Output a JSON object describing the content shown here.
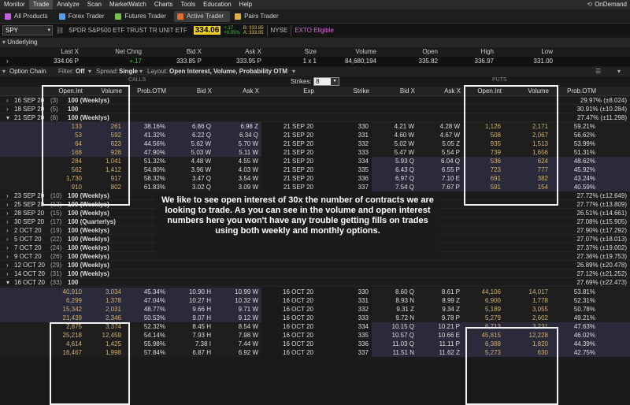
{
  "menu": [
    "Monitor",
    "Trade",
    "Analyze",
    "Scan",
    "MarketWatch",
    "Charts",
    "Tools",
    "Education",
    "Help"
  ],
  "menu_active": "Trade",
  "ondemand": "OnDemand",
  "tabs": [
    {
      "label": "All Products",
      "icon": "grid-icon",
      "color": "#c060e0"
    },
    {
      "label": "Forex Trader",
      "icon": "forex-icon",
      "color": "#5aa0e0"
    },
    {
      "label": "Futures Trader",
      "icon": "futures-icon",
      "color": "#7ac050"
    },
    {
      "label": "Active Trader",
      "icon": "active-trader-icon",
      "color": "#e07030"
    },
    {
      "label": "Pairs Trader",
      "icon": "pairs-icon",
      "color": "#e0b040"
    }
  ],
  "symbol": {
    "ticker": "SPY",
    "name": "SPDR S&P500 ETF TRUST TR UNIT ETF",
    "price": "334.06",
    "change": "+.17",
    "change_pct": "+0.05%",
    "bid": "B: 333.85",
    "ask": "A: 333.95",
    "exchange": "NYSE",
    "status": "EXTO Eligible"
  },
  "underlying": {
    "title": "Underlying",
    "columns": [
      "Last X",
      "Net Chng",
      "Bid X",
      "Ask X",
      "Size",
      "Volume",
      "Open",
      "High",
      "Low"
    ],
    "values": [
      "334.06 P",
      "+.17",
      "333.85 P",
      "333.95 P",
      "1 x 1",
      "84,680,194",
      "335.82",
      "336.97",
      "331.00"
    ]
  },
  "chain_bar": {
    "title": "Option Chain",
    "filter_label": "Filter:",
    "filter_value": "Off",
    "spread_label": "Spread:",
    "spread_value": "Single",
    "layout_label": "Layout:",
    "layout_value": "Open Interest, Volume, Probability OTM"
  },
  "calls_label": "CALLS",
  "puts_label": "PUTS",
  "strikes_label": "Strikes:",
  "strikes_value": "8",
  "headers": {
    "call": [
      "Open.Int",
      "Volume",
      "Prob.OTM",
      "Bid X",
      "Ask X"
    ],
    "mid": [
      "Exp",
      "Strike"
    ],
    "put": [
      "Bid X",
      "Ask X",
      "Open.Int",
      "Volume",
      "Prob.OTM"
    ]
  },
  "expirations_top": [
    {
      "date": "16 SEP 20",
      "days": "(3)",
      "series": "100 (Weeklys)",
      "prob": "29.97% (±8.024)",
      "open": false
    },
    {
      "date": "18 SEP 20",
      "days": "(5)",
      "series": "100",
      "prob": "30.91% (±10.284)",
      "open": false
    },
    {
      "date": "21 SEP 20",
      "days": "(8)",
      "series": "100 (Weeklys)",
      "prob": "27.47% (±11.298)",
      "open": true
    }
  ],
  "rows_sep21": [
    {
      "c_oi": "133",
      "c_vol": "261",
      "c_prob": "38.16%",
      "c_bid": "6.86 Q",
      "c_ask": "6.98 Z",
      "exp": "21 SEP 20",
      "strike": "330",
      "p_bid": "4.21 W",
      "p_ask": "4.28 W",
      "p_oi": "1,126",
      "p_vol": "2,171",
      "p_prob": "59.21%"
    },
    {
      "c_oi": "53",
      "c_vol": "592",
      "c_prob": "41.32%",
      "c_bid": "6.22 Q",
      "c_ask": "6.34 Q",
      "exp": "21 SEP 20",
      "strike": "331",
      "p_bid": "4.60 W",
      "p_ask": "4.67 W",
      "p_oi": "508",
      "p_vol": "2,067",
      "p_prob": "56.62%"
    },
    {
      "c_oi": "64",
      "c_vol": "623",
      "c_prob": "44.56%",
      "c_bid": "5.62 W",
      "c_ask": "5.70 W",
      "exp": "21 SEP 20",
      "strike": "332",
      "p_bid": "5.02 W",
      "p_ask": "5.05 Z",
      "p_oi": "935",
      "p_vol": "1,513",
      "p_prob": "53.99%"
    },
    {
      "c_oi": "168",
      "c_vol": "926",
      "c_prob": "47.90%",
      "c_bid": "5.03 W",
      "c_ask": "5.11 W",
      "exp": "21 SEP 20",
      "strike": "333",
      "p_bid": "5.47 W",
      "p_ask": "5.54 P",
      "p_oi": "739",
      "p_vol": "1,656",
      "p_prob": "51.31%"
    },
    {
      "c_oi": "284",
      "c_vol": "1,041",
      "c_prob": "51.32%",
      "c_bid": "4.48 W",
      "c_ask": "4.55 W",
      "exp": "21 SEP 20",
      "strike": "334",
      "p_bid": "5.93 Q",
      "p_ask": "6.04 Q",
      "p_oi": "536",
      "p_vol": "624",
      "p_prob": "48.62%"
    },
    {
      "c_oi": "562",
      "c_vol": "1,412",
      "c_prob": "54.80%",
      "c_bid": "3.96 W",
      "c_ask": "4.03 W",
      "exp": "21 SEP 20",
      "strike": "335",
      "p_bid": "6.43 Q",
      "p_ask": "6.55 P",
      "p_oi": "723",
      "p_vol": "777",
      "p_prob": "45.92%"
    },
    {
      "c_oi": "1,730",
      "c_vol": "917",
      "c_prob": "58.32%",
      "c_bid": "3.47 Q",
      "c_ask": "3.54 W",
      "exp": "21 SEP 20",
      "strike": "336",
      "p_bid": "6.97 Q",
      "p_ask": "7.10 E",
      "p_oi": "691",
      "p_vol": "382",
      "p_prob": "43.24%"
    },
    {
      "c_oi": "910",
      "c_vol": "802",
      "c_prob": "61.83%",
      "c_bid": "3.02 Q",
      "c_ask": "3.09 W",
      "exp": "21 SEP 20",
      "strike": "337",
      "p_bid": "7.54 Q",
      "p_ask": "7.67 P",
      "p_oi": "591",
      "p_vol": "154",
      "p_prob": "40.59%"
    }
  ],
  "expirations_mid": [
    {
      "date": "23 SEP 20",
      "days": "(10)",
      "series": "100 (Weeklys)",
      "prob": "27.72% (±12.649)"
    },
    {
      "date": "25 SEP 20",
      "days": "(12)",
      "series": "100 (Weeklys)",
      "prob": "27.77% (±13.809)"
    },
    {
      "date": "28 SEP 20",
      "days": "(15)",
      "series": "100 (Weeklys)",
      "prob": "26.51% (±14.661)"
    },
    {
      "date": "30 SEP 20",
      "days": "(17)",
      "series": "100 (Quarterlys)",
      "prob": "27.08% (±15.905)"
    },
    {
      "date": "2 OCT 20",
      "days": "(19)",
      "series": "100 (Weeklys)",
      "prob": "27.90% (±17.292)"
    },
    {
      "date": "5 OCT 20",
      "days": "(22)",
      "series": "100 (Weeklys)",
      "prob": "27.07% (±18.013)"
    },
    {
      "date": "7 OCT 20",
      "days": "(24)",
      "series": "100 (Weeklys)",
      "prob": "27.37% (±19.002)"
    },
    {
      "date": "9 OCT 20",
      "days": "(26)",
      "series": "100 (Weeklys)",
      "prob": "27.36% (±19.753)"
    },
    {
      "date": "12 OCT 20",
      "days": "(29)",
      "series": "100 (Weeklys)",
      "prob": "26.89% (±20.478)"
    },
    {
      "date": "14 OCT 20",
      "days": "(31)",
      "series": "100 (Weeklys)",
      "prob": "27.12% (±21.252)"
    },
    {
      "date": "16 OCT 20",
      "days": "(33)",
      "series": "100",
      "prob": "27.69% (±22.473)"
    }
  ],
  "rows_oct16": [
    {
      "c_oi": "40,910",
      "c_vol": "3,034",
      "c_prob": "45.34%",
      "c_bid": "10.90 H",
      "c_ask": "10.99 W",
      "exp": "16 OCT 20",
      "strike": "330",
      "p_bid": "8.60 Q",
      "p_ask": "8.61 P",
      "p_oi": "44,106",
      "p_vol": "14,017",
      "p_prob": "53.81%"
    },
    {
      "c_oi": "6,299",
      "c_vol": "1,378",
      "c_prob": "47.04%",
      "c_bid": "10.27 H",
      "c_ask": "10.32 W",
      "exp": "16 OCT 20",
      "strike": "331",
      "p_bid": "8.93 N",
      "p_ask": "8.99 Z",
      "p_oi": "6,900",
      "p_vol": "1,778",
      "p_prob": "52.31%"
    },
    {
      "c_oi": "15,342",
      "c_vol": "2,031",
      "c_prob": "48.77%",
      "c_bid": "9.66 H",
      "c_ask": "9.71 W",
      "exp": "16 OCT 20",
      "strike": "332",
      "p_bid": "9.31 Z",
      "p_ask": "9.34 Z",
      "p_oi": "5,189",
      "p_vol": "3,055",
      "p_prob": "50.78%"
    },
    {
      "c_oi": "21,439",
      "c_vol": "2,346",
      "c_prob": "50.53%",
      "c_bid": "9.07 H",
      "c_ask": "9.12 W",
      "exp": "16 OCT 20",
      "strike": "333",
      "p_bid": "9.72 N",
      "p_ask": "9.78 P",
      "p_oi": "5,279",
      "p_vol": "2,602",
      "p_prob": "49.21%"
    },
    {
      "c_oi": "2,875",
      "c_vol": "3,374",
      "c_prob": "52.32%",
      "c_bid": "8.45 H",
      "c_ask": "8.54 W",
      "exp": "16 OCT 20",
      "strike": "334",
      "p_bid": "10.15 Q",
      "p_ask": "10.21 P",
      "p_oi": "6,713",
      "p_vol": "3,231",
      "p_prob": "47.63%"
    },
    {
      "c_oi": "25,218",
      "c_vol": "12,459",
      "c_prob": "54.14%",
      "c_bid": "7.93 H",
      "c_ask": "7.98 W",
      "exp": "16 OCT 20",
      "strike": "335",
      "p_bid": "10.57 Q",
      "p_ask": "10.66 E",
      "p_oi": "45,815",
      "p_vol": "12,228",
      "p_prob": "46.02%"
    },
    {
      "c_oi": "4,614",
      "c_vol": "1,425",
      "c_prob": "55.98%",
      "c_bid": "7.38 I",
      "c_ask": "7.44 W",
      "exp": "16 OCT 20",
      "strike": "336",
      "p_bid": "11.03 Q",
      "p_ask": "11.11 P",
      "p_oi": "6,388",
      "p_vol": "1,820",
      "p_prob": "44.39%"
    },
    {
      "c_oi": "16,467",
      "c_vol": "1,998",
      "c_prob": "57.84%",
      "c_bid": "6.87 H",
      "c_ask": "6.92 W",
      "exp": "16 OCT 20",
      "strike": "337",
      "p_bid": "11.51 N",
      "p_ask": "11.62 Z",
      "p_oi": "5,273",
      "p_vol": "630",
      "p_prob": "42.75%"
    }
  ],
  "overlay": {
    "text": "We like to see open interest of 30x the number of contracts we are looking to trade. As you can see in the volume and open interest numbers here you won't have any trouble getting fills on trades using both weekly and monthly options."
  },
  "colors": {
    "itm_call": "#2a2838",
    "otm_call": "#1d1d1d",
    "itm_put": "#2a2838",
    "positive": "#39c439",
    "accent_price": "#f0d020"
  }
}
